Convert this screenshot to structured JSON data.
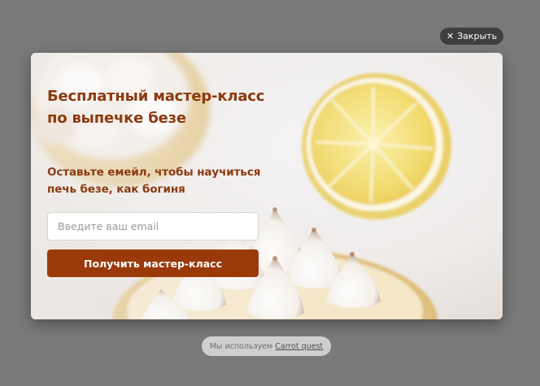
{
  "close": {
    "label": "Закрыть"
  },
  "popup": {
    "title": "Бесплатный мастер-класс по выпечке безе",
    "subtitle": "Оставьте емейл, чтобы научиться печь безе, как богиня",
    "email_placeholder": "Введите ваш email",
    "email_value": "",
    "submit_label": "Получить мастер-класс"
  },
  "footer": {
    "prefix": "Мы используем",
    "link_label": "Carrot quest"
  },
  "colors": {
    "accent": "#9a3a0a",
    "title_text": "#8c3a10",
    "overlay": "#7a7a7a"
  }
}
